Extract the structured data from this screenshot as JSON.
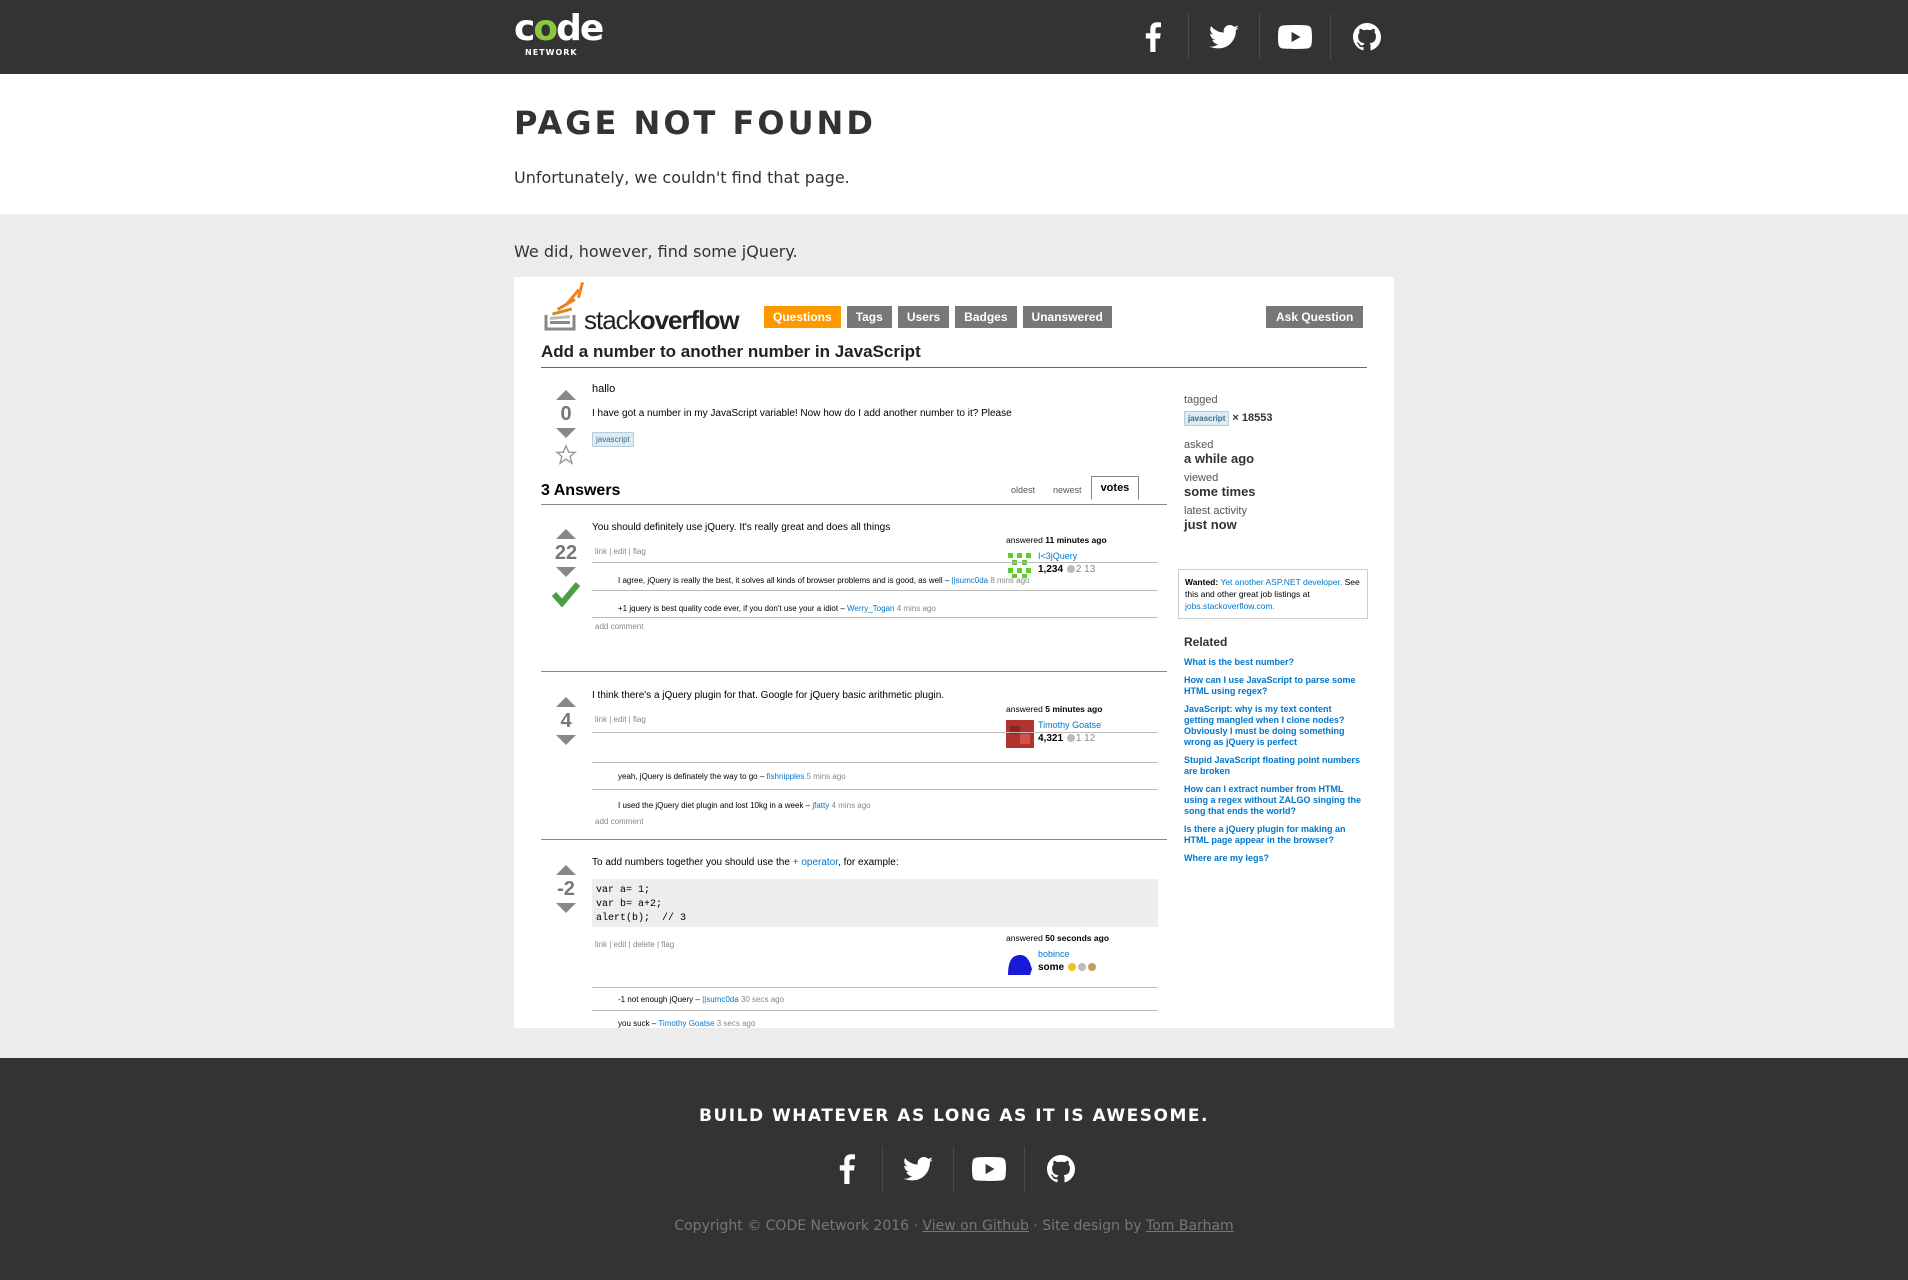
{
  "header": {
    "logo_text": "code",
    "logo_sub": "NETWORK",
    "social": [
      {
        "name": "facebook-icon"
      },
      {
        "name": "twitter-icon"
      },
      {
        "name": "youtube-icon"
      },
      {
        "name": "github-icon"
      }
    ]
  },
  "hero": {
    "title": "PAGE NOT FOUND",
    "subtitle": "Unfortunately, we couldn't find that page."
  },
  "main": {
    "jquery_line": "We did, however, find some jQuery."
  },
  "so": {
    "logo_light": "stack",
    "logo_bold": "overflow",
    "nav": [
      "Questions",
      "Tags",
      "Users",
      "Badges",
      "Unanswered"
    ],
    "ask_button": "Ask Question",
    "question_title": "Add a number to another number in JavaScript",
    "question": {
      "votes": "0",
      "greeting": "hallo",
      "body": "I have got a number in my JavaScript variable! Now how do I add another number to it? Please",
      "tag": "javascript"
    },
    "answers_header": "3 Answers",
    "tabs": [
      "oldest",
      "newest",
      "votes"
    ],
    "answers": [
      {
        "votes": "22",
        "body": "You should definitely use jQuery. It's really great and does all things",
        "actions": "link | edit | flag",
        "answered_label": "answered",
        "answered_time": "11 minutes ago",
        "user": "I<3jQuery",
        "rep": "1,234",
        "badges": "2  13",
        "comments": [
          {
            "text": "I agree, jQuery is really the best, it solves all kinds of browser problems and is good, as well –",
            "user": "||sumc0da",
            "time": "8 mins ago"
          },
          {
            "text": "+1 jquery is best quality code ever, if you don't use your a idiot –",
            "user": "Werry_Togan",
            "time": "4 mins ago"
          }
        ],
        "add_comment": "add comment"
      },
      {
        "votes": "4",
        "body": "I think there's a jQuery plugin for that. Google for jQuery basic arithmetic plugin.",
        "actions": "link | edit | flag",
        "answered_label": "answered",
        "answered_time": "5 minutes ago",
        "user": "Timothy Goatse",
        "rep": "4,321",
        "badges": "1  12",
        "comments": [
          {
            "text": "yeah, jQuery is definately the way to go –",
            "user": "fishnipples",
            "time": "5 mins ago"
          },
          {
            "text": "I used the jQuery diet plugin and lost 10kg in a week –",
            "user": "jfatty",
            "time": "4 mins ago"
          }
        ],
        "add_comment": "add comment"
      },
      {
        "votes": "-2",
        "body_pre": "To add numbers together you should use the",
        "body_link": "+ operator",
        "body_post": ", for example:",
        "code": "var a= 1;\nvar b= a+2;\nalert(b);  // 3",
        "actions": "link | edit | delete | flag",
        "answered_label": "answered",
        "answered_time": "50 seconds ago",
        "user": "bobince",
        "rep": "some",
        "comments": [
          {
            "text": "-1 not enough jQuery –",
            "user": "||sumc0da",
            "time": "30 secs ago"
          },
          {
            "text": "you suck –",
            "user": "Timothy Goatse",
            "time": "3 secs ago"
          }
        ]
      }
    ],
    "sidebar": {
      "tagged_label": "tagged",
      "tag": "javascript",
      "tag_count": "× 18553",
      "asked_label": "asked",
      "asked_val": "a while ago",
      "viewed_label": "viewed",
      "viewed_val": "some times",
      "activity_label": "latest activity",
      "activity_val": "just now",
      "wanted_label": "Wanted:",
      "wanted_link": "Yet another ASP.NET developer.",
      "wanted_text": "See this and other great job listings at",
      "wanted_site": "jobs.stackoverflow.com.",
      "related_label": "Related",
      "related": [
        "What is the best number?",
        "How can I use JavaScript to parse some HTML using regex?",
        "JavaScript: why is my text content getting mangled when I clone nodes? Obviously I must be doing something wrong as jQuery is perfect",
        "Stupid JavaScript floating point numbers are broken",
        "How can I extract number from HTML using a regex without ZALGO singing the song that ends the world?",
        "Is there a jQuery plugin for making an HTML page appear in the browser?",
        "Where are my legs?"
      ]
    }
  },
  "footer": {
    "tagline": "BUILD WHATEVER AS LONG AS IT IS AWESOME.",
    "copyright_pre": "Copyright © CODE Network 2016 ·",
    "github_link": "View on Github",
    "design_text": "· Site design by",
    "designer_link": "Tom Barham"
  },
  "colors": {
    "header_bg": "#333333",
    "accent": "#8cc63f",
    "so_orange": "#ff9900",
    "link_blue": "#0077cc"
  }
}
